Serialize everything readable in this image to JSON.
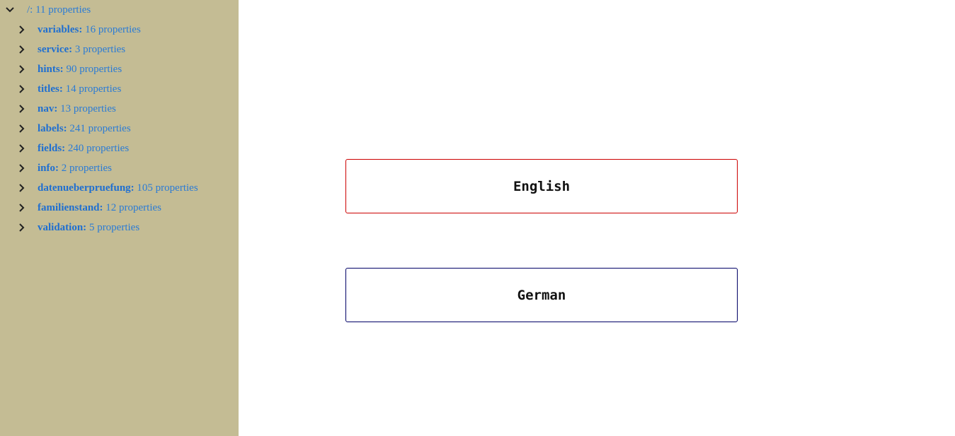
{
  "tree": {
    "root": {
      "key": "/:",
      "count": "11 properties"
    },
    "items": [
      {
        "key": "variables:",
        "count": "16 properties"
      },
      {
        "key": "service:",
        "count": "3 properties"
      },
      {
        "key": "hints:",
        "count": "90 properties"
      },
      {
        "key": "titles:",
        "count": "14 properties"
      },
      {
        "key": "nav:",
        "count": "13 properties"
      },
      {
        "key": "labels:",
        "count": "241 properties"
      },
      {
        "key": "fields:",
        "count": "240 properties"
      },
      {
        "key": "info:",
        "count": "2 properties"
      },
      {
        "key": "datenueberpruefung:",
        "count": "105 properties"
      },
      {
        "key": "familienstand:",
        "count": "12 properties"
      },
      {
        "key": "validation:",
        "count": "5 properties"
      }
    ]
  },
  "languages": {
    "english": {
      "label": "English",
      "border_color": "#cc0000"
    },
    "german": {
      "label": "German",
      "border_color": "#000066"
    }
  },
  "colors": {
    "sidebar_background": "#c4bc94",
    "tree_text": "#2a7bd6"
  }
}
